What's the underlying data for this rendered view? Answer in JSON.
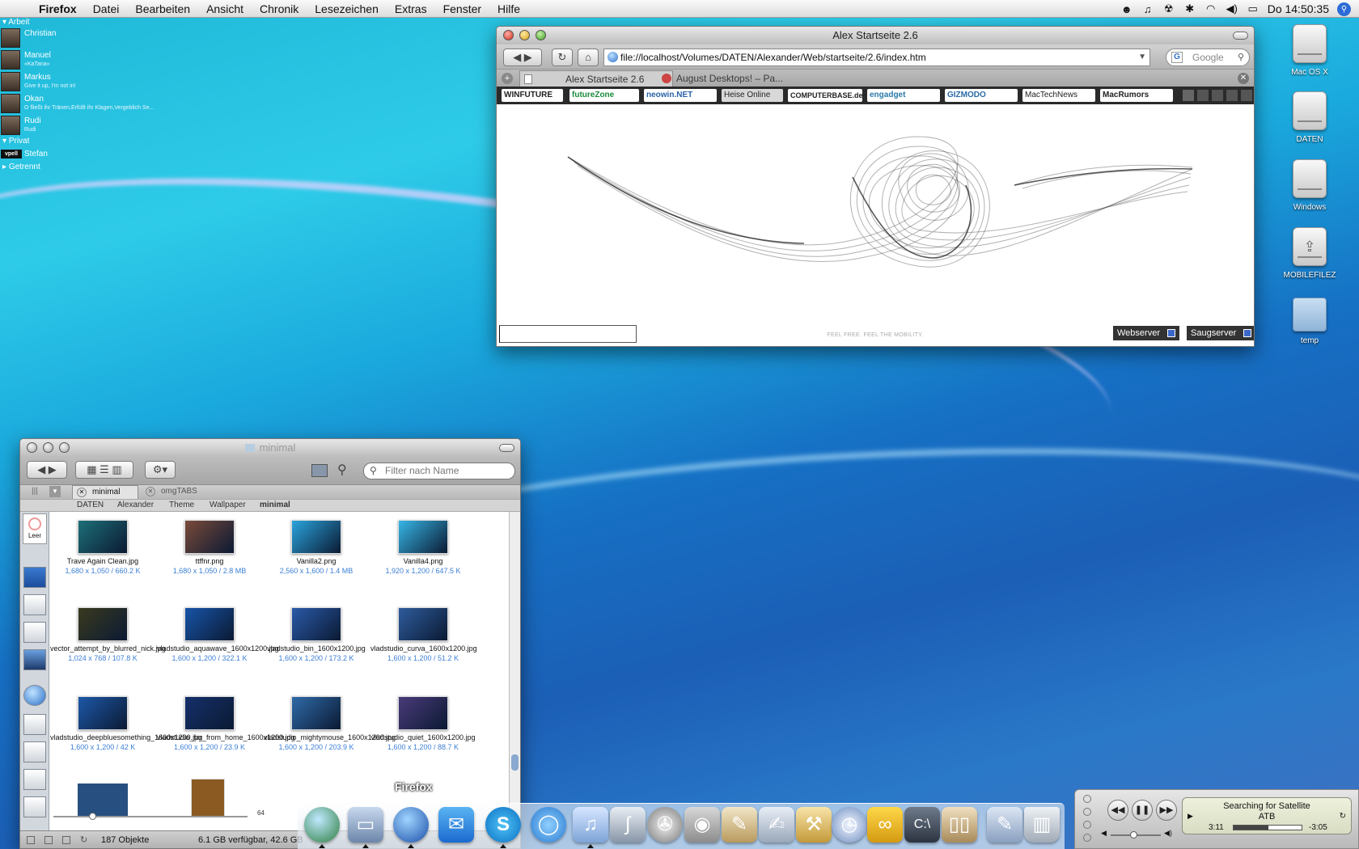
{
  "menubar": {
    "app": "Firefox",
    "items": [
      "Datei",
      "Bearbeiten",
      "Ansicht",
      "Chronik",
      "Lesezeichen",
      "Extras",
      "Fenster",
      "Hilfe"
    ],
    "clock": "Do 14:50:35"
  },
  "buddy_list": {
    "group_work": "Arbeit",
    "buddies": [
      {
        "name": "Christian",
        "status": ""
      },
      {
        "name": "Manuel",
        "status": "«KaTana»"
      },
      {
        "name": "Markus",
        "status": "Give it up, I'm not in!"
      },
      {
        "name": "Okan",
        "status": "O fließt ihr Tränen,Erfüllt ihr Klagen,Vergeblich Se..."
      },
      {
        "name": "Rudi",
        "status": "Rudi"
      }
    ],
    "group_private": "Privat",
    "private_buddy": {
      "name": "Stefan",
      "badge": "vpell"
    },
    "group_disconnected": "Getrennt"
  },
  "firefox": {
    "title": "Alex Startseite 2.6",
    "url": "file://localhost/Volumes/DATEN/Alexander/Web/startseite/2.6/index.htm",
    "search_placeholder": "Google",
    "tabs": [
      "Alex Startseite 2.6",
      "August Desktops! – Pa..."
    ],
    "bookmarks": [
      "WINFUTURE",
      "futureZone",
      "neowin.NET",
      "Heise Online",
      "COMPUTERBASE.de",
      "engadget",
      "GIZMODO",
      "MacTechNews",
      "MacRumors"
    ],
    "tagline": "FEEL FREE. FEEL THE MOBILITY.",
    "btn_webserver": "Webserver",
    "btn_saugserver": "Saugserver"
  },
  "desktop_icons": [
    "Mac OS X",
    "DATEN",
    "Windows",
    "MOBILEFILEZ",
    "temp"
  ],
  "finder": {
    "title": "minimal",
    "search_placeholder": "Filter nach Name",
    "tabs": [
      "minimal",
      "omgTABS"
    ],
    "path": [
      "DATEN",
      "Alexander",
      "Theme",
      "Wallpaper",
      "minimal"
    ],
    "sidebar_label": "Leer",
    "items": [
      {
        "name": "Trave Again Clean.jpg",
        "info": "1,680 x 1,050 / 660.2 K",
        "color": "#1d6f78"
      },
      {
        "name": "ttffnr.png",
        "info": "1,680 x 1,050 / 2.8 MB",
        "color": "#7a4a3a"
      },
      {
        "name": "Vanilla2.png",
        "info": "2,560 x 1,600 / 1.4 MB",
        "color": "#2aa4dd"
      },
      {
        "name": "Vanilla4.png",
        "info": "1,920 x 1,200 / 647.5 K",
        "color": "#37b6e6"
      },
      {
        "name": "vector_attempt_by_blurred_nick.jpg",
        "info": "1,024 x 768 / 107.8 K",
        "color": "#3a3a1e"
      },
      {
        "name": "vladstudio_aquawave_1600x1200.jpg",
        "info": "1,600 x 1,200 / 322.1 K",
        "color": "#1754a8"
      },
      {
        "name": "vladstudio_bin_1600x1200.jpg",
        "info": "1,600 x 1,200 / 173.2 K",
        "color": "#2a5aa8"
      },
      {
        "name": "vladstudio_curva_1600x1200.jpg",
        "info": "1,600 x 1,200 / 51.2 K",
        "color": "#2e5c9c"
      },
      {
        "name": "vladstudio_deepbluesomething_1600x1200.jpg",
        "info": "1,600 x 1,200 / 42 K",
        "color": "#1d58a8"
      },
      {
        "name": "vladstudio_far_from_home_1600x1200.jpg",
        "info": "1,600 x 1,200 / 23.9 K",
        "color": "#15306a"
      },
      {
        "name": "vladstudio_mightymouse_1600x1200.jpg",
        "info": "1,600 x 1,200 / 203.9 K",
        "color": "#2f6aa8"
      },
      {
        "name": "vladstudio_quiet_1600x1200.jpg",
        "info": "1,600 x 1,200 / 88.7 K",
        "color": "#4a3a7a"
      }
    ],
    "slider_value": "64",
    "status_count": "187 Objekte",
    "status_free": "6.1 GB verfügbar, 42.6 GB"
  },
  "dock": {
    "hover_label": "Firefox"
  },
  "itunes_widget": {
    "track": "Searching for Satellite",
    "artist": "ATB",
    "elapsed": "3:11",
    "remaining": "-3:05",
    "progress": 0.51
  }
}
